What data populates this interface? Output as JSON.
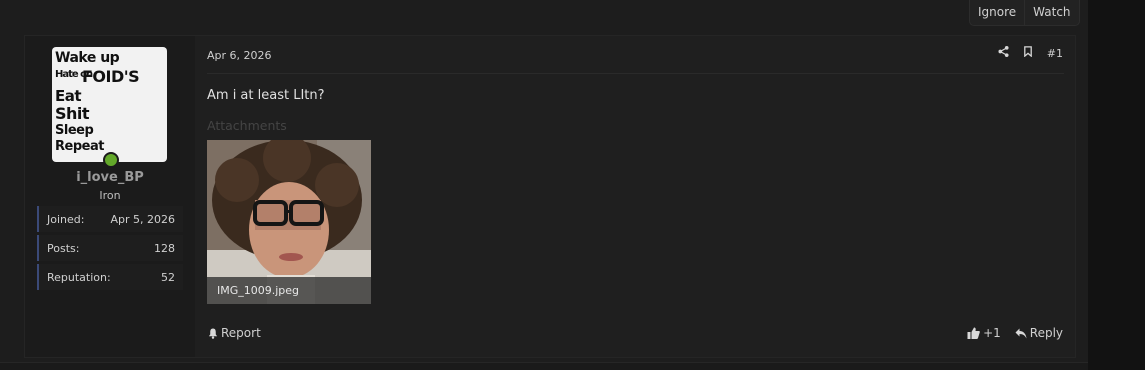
{
  "thread_actions": {
    "ignore_label": "Ignore",
    "watch_label": "Watch"
  },
  "user": {
    "username": "i_love_BP",
    "rank": "Iron",
    "online": true,
    "avatar_text": {
      "line1": "Wake up",
      "line2a": "Hate on",
      "line2b": "FOID'S",
      "line3": "Eat",
      "line4": "Shit",
      "line5": "Sleep",
      "line6": "Repeat"
    },
    "stats": [
      {
        "label": "Joined:",
        "value": "Apr 5, 2026"
      },
      {
        "label": "Posts:",
        "value": "128"
      },
      {
        "label": "Reputation:",
        "value": "52"
      }
    ]
  },
  "post": {
    "date": "Apr 6, 2026",
    "number": "#1",
    "message": "Am i at least LItn?",
    "attachments_label": "Attachments",
    "attachment": {
      "filename": "IMG_1009.jpeg"
    },
    "report_label": "Report",
    "reaction_count": "+1",
    "reply_label": "Reply"
  },
  "colors": {
    "online": "#63a82a",
    "stat_accent": "#3b4a78"
  },
  "icons": [
    "share-icon",
    "bookmark-icon",
    "bell-icon",
    "thumbs-up-icon",
    "reply-icon"
  ]
}
